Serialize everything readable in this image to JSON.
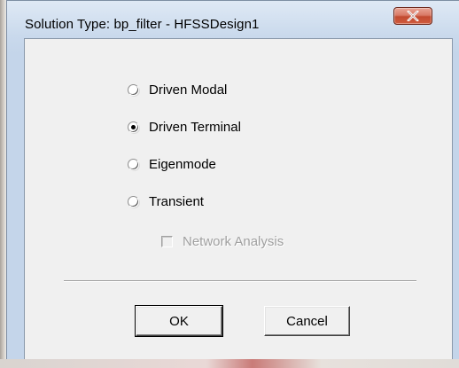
{
  "window": {
    "title": "Solution Type: bp_filter - HFSSDesign1",
    "close_icon": "close-x-icon"
  },
  "solution_types": [
    {
      "label": "Driven Modal",
      "checked": false
    },
    {
      "label": "Driven Terminal",
      "checked": true
    },
    {
      "label": "Eigenmode",
      "checked": false
    },
    {
      "label": "Transient",
      "checked": false
    }
  ],
  "network_analysis": {
    "label": "Network Analysis",
    "checked": false,
    "enabled": false
  },
  "buttons": {
    "ok_label": "OK",
    "cancel_label": "Cancel"
  },
  "colors": {
    "close_button": "#c24a30",
    "dialog_body": "#f0f0f0",
    "window_frame": "#c4d5ea",
    "disabled_text": "#a0a0a0"
  }
}
